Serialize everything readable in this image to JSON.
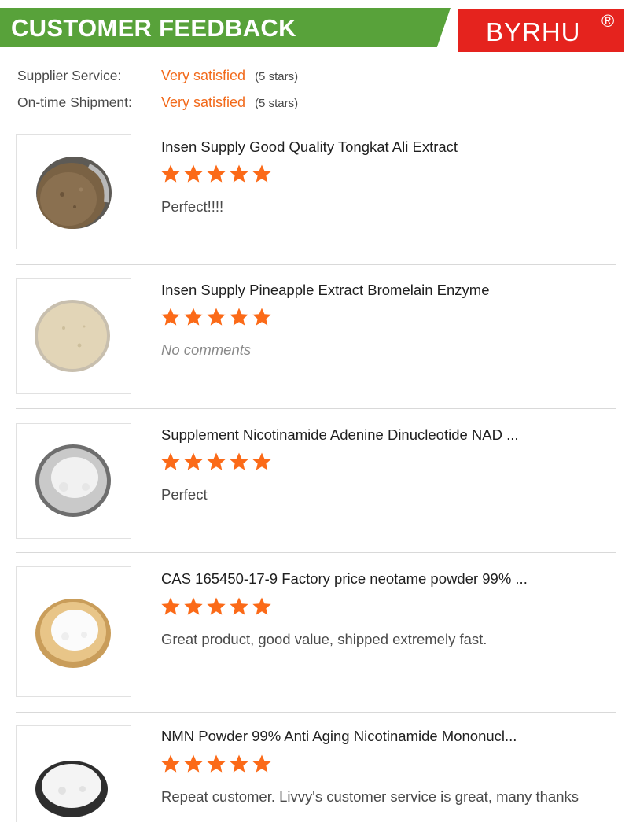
{
  "header": {
    "title": "CUSTOMER FEEDBACK",
    "brand": "BYRHU",
    "brand_mark": "®",
    "accent_green": "#58a23a",
    "accent_red": "#e5231e"
  },
  "summary": [
    {
      "label": "Supplier Service:",
      "value": "Very satisfied",
      "stars_text": "(5 stars)"
    },
    {
      "label": "On-time Shipment:",
      "value": "Very satisfied",
      "stars_text": "(5 stars)"
    }
  ],
  "star_color": "#fb6a18",
  "reviews": [
    {
      "title": "Insen Supply Good Quality Tongkat Ali Extract",
      "rating": 5,
      "comment": "Perfect!!!!",
      "image_icon": "brown-powder-dish-icon"
    },
    {
      "title": "Insen Supply Pineapple Extract Bromelain Enzyme",
      "rating": 5,
      "comment": "No comments",
      "image_icon": "beige-powder-dish-icon"
    },
    {
      "title": "Supplement Nicotinamide Adenine Dinucleotide NAD ...",
      "rating": 5,
      "comment": "Perfect",
      "image_icon": "white-powder-dish-icon"
    },
    {
      "title": "CAS 165450-17-9 Factory price neotame powder 99% ...",
      "rating": 5,
      "comment": "Great product, good value, shipped extremely fast.",
      "image_icon": "white-powder-wooden-bowl-icon"
    },
    {
      "title": "NMN Powder 99%  Anti Aging Nicotinamide Mononucl...",
      "rating": 5,
      "comment": "Repeat customer. Livvy's customer service is great, many thanks",
      "image_icon": "white-powder-dark-dish-icon"
    }
  ]
}
